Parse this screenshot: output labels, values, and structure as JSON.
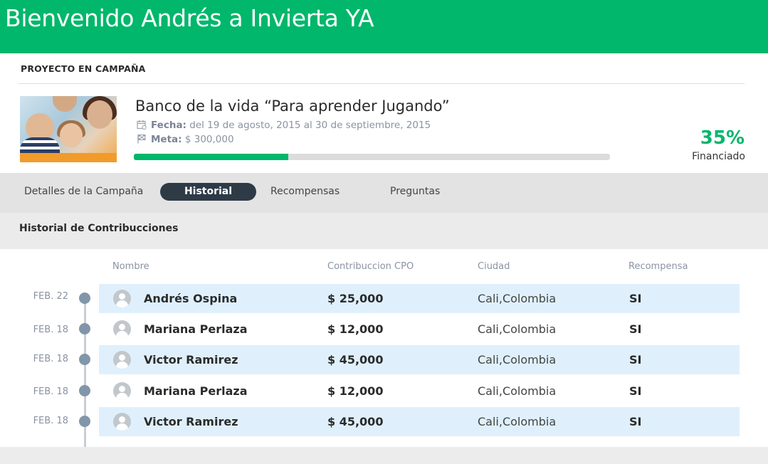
{
  "header": {
    "title": "Bienvenido Andrés a Invierta YA"
  },
  "campaign": {
    "section_label": "PROYECTO EN CAMPAÑA",
    "title": "Banco de la vida “Para aprender Jugando”",
    "fecha_label": "Fecha:",
    "fecha_value": "del 19 de agosto, 2015 al 30 de septiembre, 2015",
    "meta_label": "Meta:",
    "meta_value": "$ 300,000",
    "funded_percent": "35%",
    "funded_label": "Financiado",
    "progress_fraction": 0.325
  },
  "tabs": [
    {
      "label": "Detalles de la Campaña",
      "active": false
    },
    {
      "label": "Historial",
      "active": true
    },
    {
      "label": "Recompensas",
      "active": false
    },
    {
      "label": "Preguntas",
      "active": false
    }
  ],
  "history": {
    "title": "Historial de Contribucciones",
    "columns": [
      "Nombre",
      "Contribuccion CPO",
      "Ciudad",
      "Recompensa"
    ],
    "rows": [
      {
        "date": "FEB. 22",
        "name": "Andrés Ospina",
        "amount": "$ 25,000",
        "city": "Cali,Colombia",
        "reward": "SI"
      },
      {
        "date": "FEB. 18",
        "name": "Mariana Perlaza",
        "amount": "$ 12,000",
        "city": "Cali,Colombia",
        "reward": "SI"
      },
      {
        "date": "FEB. 18",
        "name": "Victor Ramirez",
        "amount": "$ 45,000",
        "city": "Cali,Colombia",
        "reward": "SI"
      },
      {
        "date": "FEB. 18",
        "name": "Mariana Perlaza",
        "amount": "$ 12,000",
        "city": "Cali,Colombia",
        "reward": "SI"
      },
      {
        "date": "FEB. 18",
        "name": "Victor Ramirez",
        "amount": "$ 45,000",
        "city": "Cali,Colombia",
        "reward": "SI"
      }
    ]
  },
  "icons": {
    "fecha": "calendar-icon",
    "meta": "flag-icon",
    "avatar": "user-avatar-icon"
  },
  "colors": {
    "brand_green": "#00b76b",
    "active_tab": "#2e3b47",
    "row_highlight": "#dff0fc",
    "timeline_dot": "#8196a8"
  }
}
